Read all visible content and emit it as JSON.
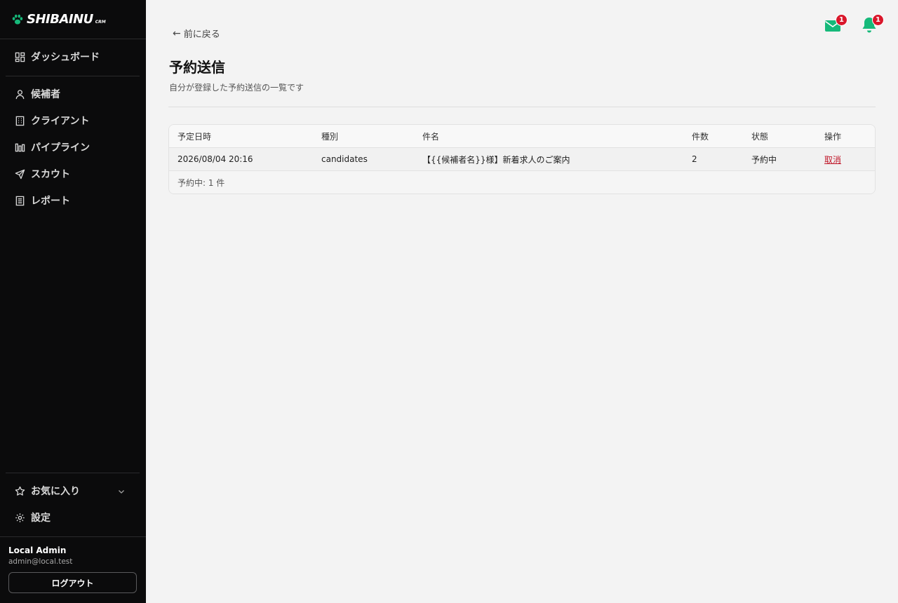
{
  "brand": {
    "name": "SHIBAINU",
    "sub": "CRM"
  },
  "sidebar": {
    "items": [
      {
        "label": "ダッシュボード",
        "icon": "dashboard-icon"
      },
      {
        "label": "候補者",
        "icon": "user-icon"
      },
      {
        "label": "クライアント",
        "icon": "building-icon"
      },
      {
        "label": "パイプライン",
        "icon": "pipeline-icon"
      },
      {
        "label": "スカウト",
        "icon": "send-icon"
      },
      {
        "label": "レポート",
        "icon": "report-icon"
      }
    ],
    "bottom_items": [
      {
        "label": "お気に入り",
        "icon": "star-icon"
      },
      {
        "label": "設定",
        "icon": "gear-icon"
      }
    ],
    "user": {
      "name": "Local Admin",
      "email": "admin@local.test"
    },
    "logout_label": "ログアウト"
  },
  "header": {
    "back_label": "前に戻る",
    "mail_badge": "1",
    "bell_badge": "1"
  },
  "page": {
    "title": "予約送信",
    "subtitle": "自分が登録した予約送信の一覧です"
  },
  "table": {
    "columns": [
      "予定日時",
      "種別",
      "件名",
      "件数",
      "状態",
      "操作"
    ],
    "rows": [
      {
        "date": "2026/08/04 20:16",
        "type": "candidates",
        "subject": "【{{候補者名}}様】新着求人のご案内",
        "count": "2",
        "status": "予約中",
        "action": "取消"
      }
    ],
    "footer": "予約中: 1 件"
  },
  "colors": {
    "accent": "#16b97a",
    "badge": "#d9172b",
    "sidebar_bg": "#0b0b0c",
    "danger_link": "#c0182a"
  }
}
